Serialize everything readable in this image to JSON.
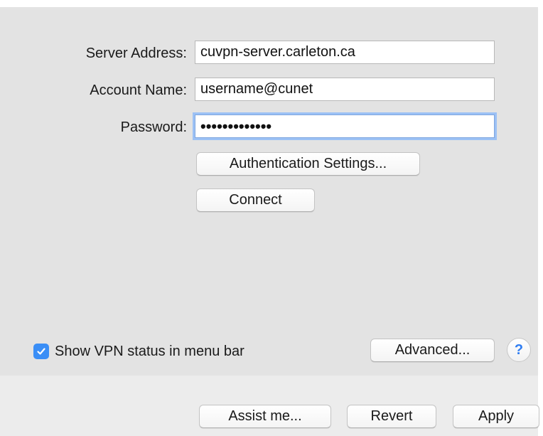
{
  "form": {
    "server_address_label": "Server Address:",
    "server_address_value": "cuvpn-server.carleton.ca",
    "account_name_label": "Account Name:",
    "account_name_value": "username@cunet",
    "password_label": "Password:",
    "password_value": "•••••••••••••"
  },
  "buttons": {
    "auth_settings": "Authentication Settings...",
    "connect": "Connect",
    "advanced": "Advanced...",
    "help": "?",
    "assist_me": "Assist me...",
    "revert": "Revert",
    "apply": "Apply"
  },
  "options": {
    "show_vpn_status_label": "Show VPN status in menu bar",
    "show_vpn_status_checked": true
  },
  "icons": {
    "checkbox": "checkmark-icon",
    "help": "question-mark-icon"
  },
  "colors": {
    "accent": "#3a8ef6",
    "focus_ring": "#9cc1f5"
  }
}
